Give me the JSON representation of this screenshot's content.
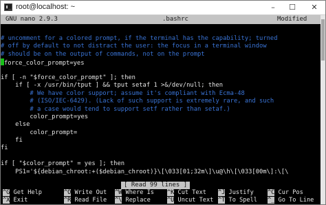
{
  "window": {
    "title": "root@localhost: ~",
    "icon": "terminal-icon",
    "controls": {
      "minimize": "–",
      "maximize": "☐",
      "close": "✕"
    }
  },
  "nano": {
    "version": "GNU nano 2.9.3",
    "filename": ".bashrc",
    "state": "Modified"
  },
  "lines": [
    {
      "text": "# uncomment for a colored prompt, if the terminal has the capability; turned",
      "type": "comment"
    },
    {
      "text": "# off by default to not distract the user: the focus in a terminal window",
      "type": "comment"
    },
    {
      "text": "# should be on the output of commands, not on the prompt",
      "type": "comment"
    },
    {
      "text": "force_color_prompt=yes",
      "type": "cursor"
    },
    {
      "text": "",
      "type": "code"
    },
    {
      "text": "if [ -n \"$force_color_prompt\" ]; then",
      "type": "code"
    },
    {
      "text": "    if [ -x /usr/bin/tput ] && tput setaf 1 >&/dev/null; then",
      "type": "code"
    },
    {
      "text": "        # We have color support; assume it's compliant with Ecma-48",
      "type": "comment"
    },
    {
      "text": "        # (ISO/IEC-6429). (Lack of such support is extremely rare, and such",
      "type": "comment"
    },
    {
      "text": "        # a case would tend to support setf rather than setaf.)",
      "type": "comment"
    },
    {
      "text": "        color_prompt=yes",
      "type": "code"
    },
    {
      "text": "    else",
      "type": "code"
    },
    {
      "text": "        color_prompt=",
      "type": "code"
    },
    {
      "text": "    fi",
      "type": "code"
    },
    {
      "text": "fi",
      "type": "code"
    },
    {
      "text": "",
      "type": "code"
    },
    {
      "text": "if [ \"$color_prompt\" = yes ]; then",
      "type": "code"
    },
    {
      "text": "    PS1='${debian_chroot:+($debian_chroot)}\\[\\033[01;32m\\]\\u@\\h\\[\\033[00m\\]:\\[\\",
      "type": "code"
    }
  ],
  "status": "[ Read 99 lines ]",
  "shortcuts": [
    [
      {
        "key": "^G",
        "label": "Get Help"
      },
      {
        "key": "^O",
        "label": "Write Out"
      },
      {
        "key": "^W",
        "label": "Where Is"
      },
      {
        "key": "^K",
        "label": "Cut Text"
      },
      {
        "key": "^J",
        "label": "Justify"
      },
      {
        "key": "^C",
        "label": "Cur Pos"
      }
    ],
    [
      {
        "key": "^X",
        "label": "Exit"
      },
      {
        "key": "^R",
        "label": "Read File"
      },
      {
        "key": "^\\",
        "label": "Replace"
      },
      {
        "key": "^U",
        "label": "Uncut Text"
      },
      {
        "key": "^T",
        "label": "To Spell"
      },
      {
        "key": "^_",
        "label": "Go To Line"
      }
    ]
  ]
}
